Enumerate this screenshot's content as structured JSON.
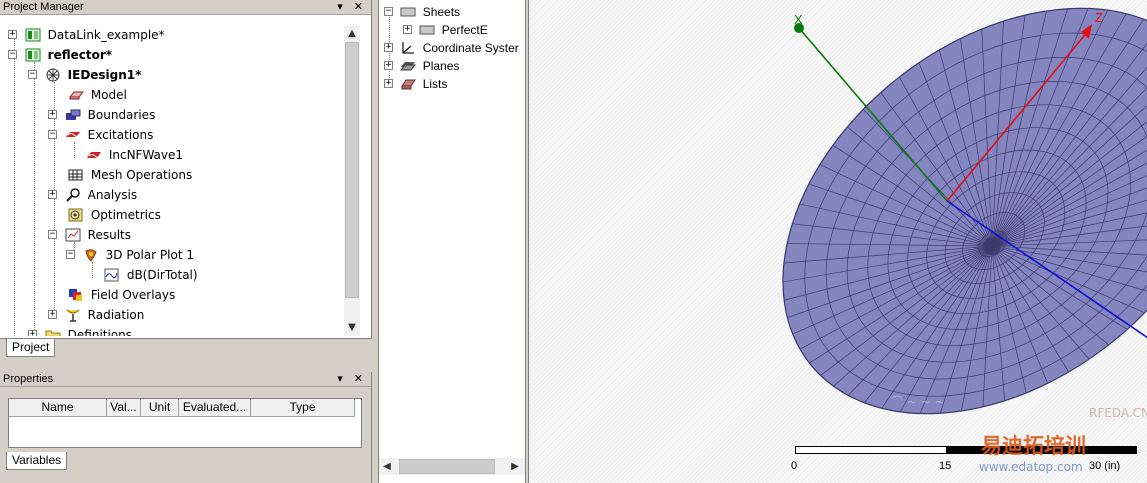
{
  "project_manager": {
    "title": "Project Manager",
    "controls": "▾ × ",
    "tree": [
      {
        "label": "DataLink_example*",
        "bold": false,
        "toggle": "+",
        "icon": "project-icon"
      },
      {
        "label": "reflector*",
        "bold": true,
        "toggle": "−",
        "icon": "project-icon"
      },
      {
        "label": "IEDesign1*",
        "bold": true,
        "toggle": "−",
        "icon": "design-icon"
      },
      {
        "label": "Model",
        "bold": false,
        "toggle": "",
        "icon": "model-icon"
      },
      {
        "label": "Boundaries",
        "bold": false,
        "toggle": "+",
        "icon": "boundaries-icon"
      },
      {
        "label": "Excitations",
        "bold": false,
        "toggle": "−",
        "icon": "excitations-icon"
      },
      {
        "label": "IncNFWave1",
        "bold": false,
        "toggle": "",
        "icon": "wave-icon"
      },
      {
        "label": "Mesh Operations",
        "bold": false,
        "toggle": "",
        "icon": "mesh-icon"
      },
      {
        "label": "Analysis",
        "bold": false,
        "toggle": "+",
        "icon": "analysis-icon"
      },
      {
        "label": "Optimetrics",
        "bold": false,
        "toggle": "",
        "icon": "optimetrics-icon"
      },
      {
        "label": "Results",
        "bold": false,
        "toggle": "−",
        "icon": "results-icon"
      },
      {
        "label": "3D Polar Plot 1",
        "bold": false,
        "toggle": "−",
        "icon": "polar-plot-icon"
      },
      {
        "label": "dB(DirTotal)",
        "bold": false,
        "toggle": "",
        "icon": "trace-icon"
      },
      {
        "label": "Field Overlays",
        "bold": false,
        "toggle": "",
        "icon": "field-overlays-icon"
      },
      {
        "label": "Radiation",
        "bold": false,
        "toggle": "+",
        "icon": "radiation-icon"
      },
      {
        "label": "Definitions",
        "bold": false,
        "toggle": "+",
        "icon": "folder-icon"
      }
    ],
    "tab": "Project"
  },
  "properties": {
    "title": "Properties",
    "controls": "▾ × ",
    "columns": [
      "Name",
      "Val...",
      "Unit",
      "Evaluated...",
      "Type"
    ],
    "tab": "Variables"
  },
  "model_tree": {
    "items": [
      {
        "label": "Sheets",
        "toggle": "−",
        "icon": "sheets-icon"
      },
      {
        "label": "PerfectE",
        "toggle": "+",
        "icon": "sheet-icon"
      },
      {
        "label": "Coordinate Syster",
        "toggle": "+",
        "icon": "coordinate-system-icon"
      },
      {
        "label": "Planes",
        "toggle": "+",
        "icon": "planes-icon"
      },
      {
        "label": "Lists",
        "toggle": "+",
        "icon": "lists-icon"
      }
    ]
  },
  "viewport": {
    "axes": {
      "x": "X",
      "z": "Z"
    },
    "colors": {
      "surface": "#8585bf",
      "mesh": "#3a3a6e",
      "x_axis": "#0a7a0a",
      "z_axis": "#e01010",
      "y_axis": "#1010d0"
    },
    "scale_ruler": {
      "ticks": [
        "0",
        "15",
        "30 (in)"
      ]
    },
    "watermark": {
      "brand": "RFEDA.CN",
      "cn_text": "易迪拓培训",
      "url": "www.edatop.com"
    }
  }
}
